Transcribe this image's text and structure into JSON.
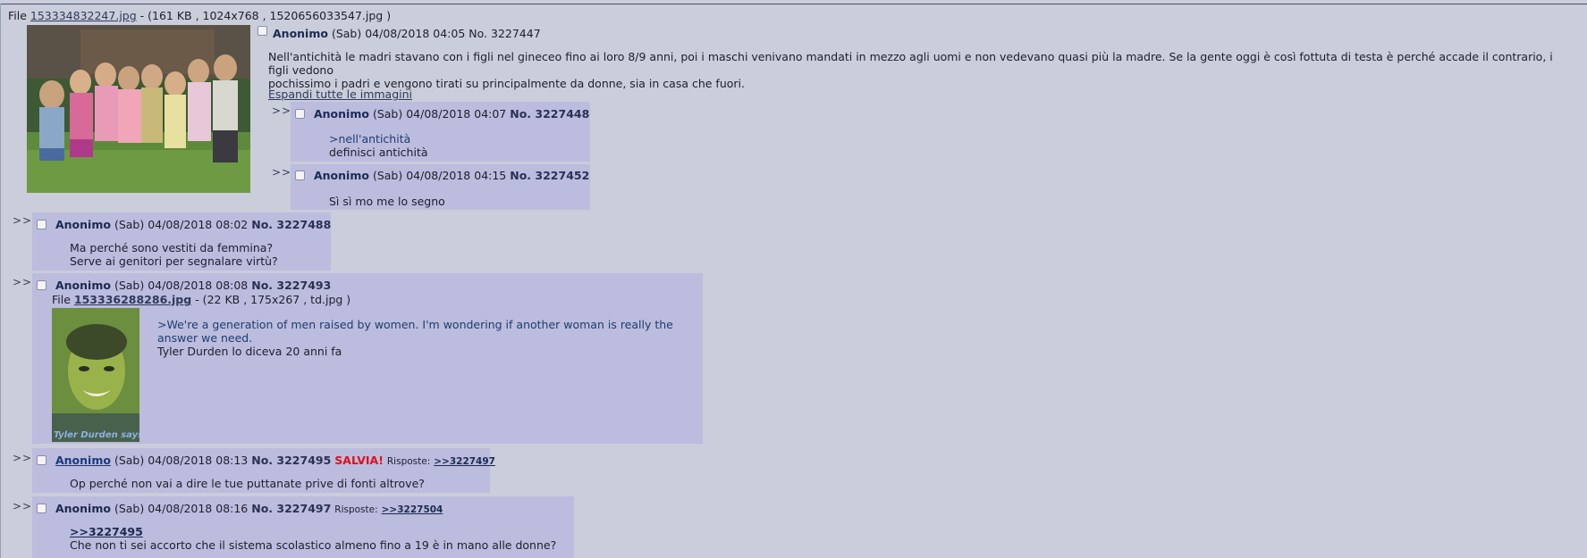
{
  "op": {
    "file_label": "File",
    "file_name": "153334832247.jpg",
    "file_meta": "- (161 KB , 1024x768 , 1520656033547.jpg )",
    "name": "Anonimo",
    "day": "(Sab)",
    "datetime": "04/08/2018 04:05",
    "number": "No. 3227447",
    "body_line1": "Nell'antichità le madri stavano con i figli nel gineceo fino ai loro 8/9 anni, poi i maschi venivano mandati in mezzo agli uomi e non vedevano quasi più la madre. Se la gente oggi è così fottuta di testa è perché accade il contrario, i figli vedono",
    "body_line2": "pochissimo i padri e vengono tirati su principalmente da donne, sia in casa che fuori.",
    "expand_link": "Espandi tutte le immagini"
  },
  "arrow": ">>",
  "replies": [
    {
      "name": "Anonimo",
      "day": "(Sab)",
      "datetime": "04/08/2018 04:07",
      "number": "No. 3227448",
      "quote": ">nell'antichità",
      "text": "definisci antichità"
    },
    {
      "name": "Anonimo",
      "day": "(Sab)",
      "datetime": "04/08/2018 04:15",
      "number": "No. 3227452",
      "text": "Sì sì mo me lo segno"
    },
    {
      "name": "Anonimo",
      "day": "(Sab)",
      "datetime": "04/08/2018 08:02",
      "number": "No. 3227488",
      "line1": "Ma perché sono vestiti da femmina?",
      "line2": "Serve ai genitori per segnalare virtù?"
    },
    {
      "name": "Anonimo",
      "day": "(Sab)",
      "datetime": "04/08/2018 08:08",
      "number": "No. 3227493",
      "file_label": "File",
      "file_name": "153336288286.jpg",
      "file_meta": "- (22 KB , 175x267 , td.jpg )",
      "quote_line1": ">We're a generation of men raised by women. I'm wondering if another woman is really the",
      "quote_line2": "answer we need.",
      "text": "Tyler Durden lo diceva 20 anni fa",
      "thumb_caption": "Tyler Durden says"
    },
    {
      "name": "Anonimo",
      "day": "(Sab)",
      "datetime": "04/08/2018 08:13",
      "number": "No. 3227495",
      "badge": "SALVIA!",
      "replies_label": "Risposte:",
      "backlink": ">>3227497",
      "text": "Op perché non vai a dire le tue puttanate prive di fonti altrove?"
    },
    {
      "name": "Anonimo",
      "day": "(Sab)",
      "datetime": "04/08/2018 08:16",
      "number": "No. 3227497",
      "replies_label": "Risposte:",
      "backlink": ">>3227504",
      "quote_link": ">>3227495",
      "text": "Che non ti sei accorto che il sistema scolastico almeno fino a 19 è in mano alle donne?"
    }
  ]
}
